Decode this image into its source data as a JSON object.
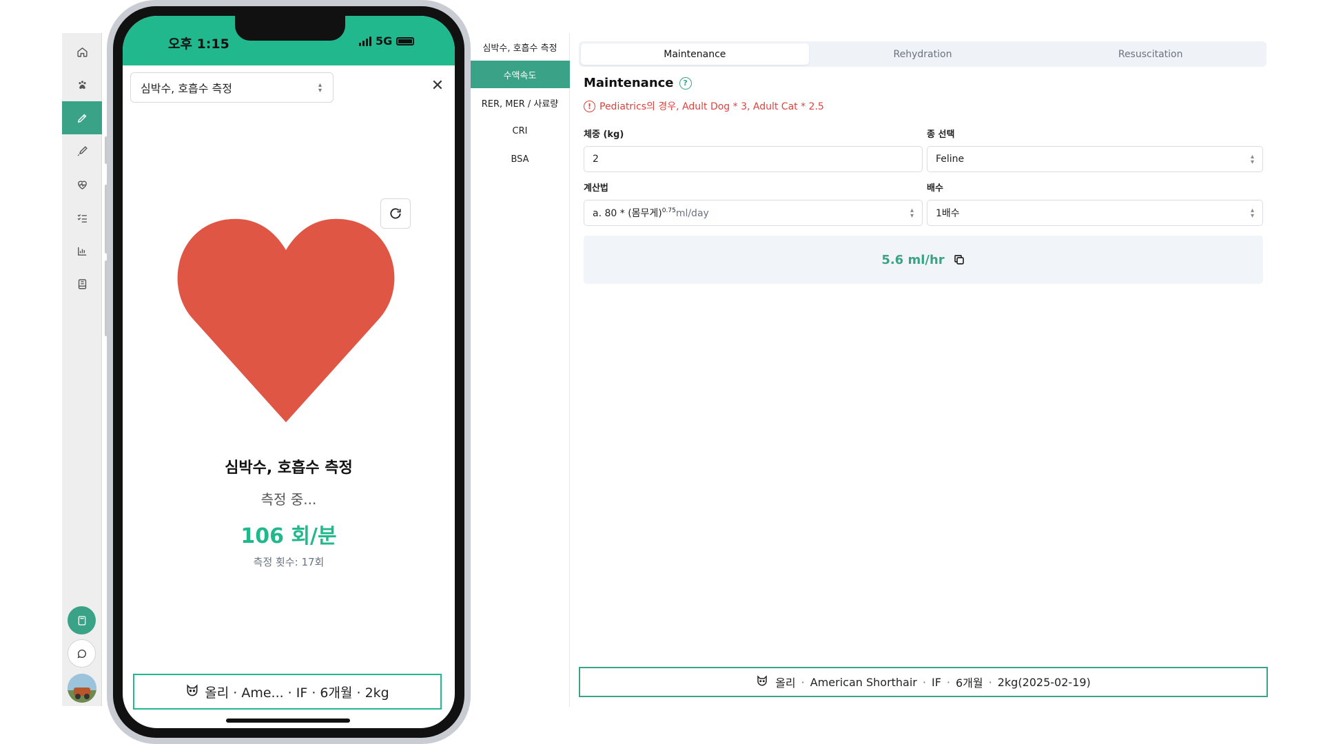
{
  "calc_nav": {
    "items": [
      {
        "label": "심박수, 호흡수 측정"
      },
      {
        "label": "수액속도"
      },
      {
        "label": "RER, MER / 사료량"
      },
      {
        "label": "CRI"
      },
      {
        "label": "BSA"
      }
    ],
    "active_index": 1
  },
  "tabs": [
    {
      "label": "Maintenance"
    },
    {
      "label": "Rehydration"
    },
    {
      "label": "Resuscitation"
    }
  ],
  "section": {
    "title": "Maintenance",
    "help_icon": "?",
    "notice_icon": "!",
    "notice": "Pediatrics의 경우, Adult Dog * 3, Adult Cat * 2.5"
  },
  "form": {
    "weight_label": "체중 (kg)",
    "weight_value": "2",
    "species_label": "종 선택",
    "species_value": "Feline",
    "method_label": "계산법",
    "method_prefix": "a. 80 * (몸무게)",
    "method_exp": "0.75",
    "method_unit": "ml/day",
    "multiplier_label": "배수",
    "multiplier_value": "1배수"
  },
  "result": {
    "value": "5.6 ml/hr"
  },
  "patient": {
    "name": "올리",
    "breed": "American Shorthair",
    "sex": "IF",
    "age": "6개월",
    "weight": "2kg(2025-02-19)",
    "sep": "·"
  },
  "phone": {
    "time": "오후 1:15",
    "network": "5G",
    "select_value": "심박수, 호흡수 측정",
    "close": "✕",
    "title": "심박수, 호흡수 측정",
    "status": "측정 중...",
    "rate": "106 회/분",
    "count": "측정 횟수: 17회",
    "patient_summary": "올리 · Ame... · IF · 6개월 · 2kg"
  },
  "colors": {
    "accent": "#3aa387",
    "phone_header": "#22b88e",
    "heart": "#e05645",
    "notice": "#e0413a"
  },
  "icons": {
    "sidebar": [
      "home-icon",
      "paw-icon",
      "pencil-icon",
      "brush-icon",
      "heart-pulse-icon",
      "checklist-icon",
      "chart-icon",
      "notebook-icon"
    ],
    "bottom": [
      "calculator-icon",
      "chat-icon"
    ]
  }
}
